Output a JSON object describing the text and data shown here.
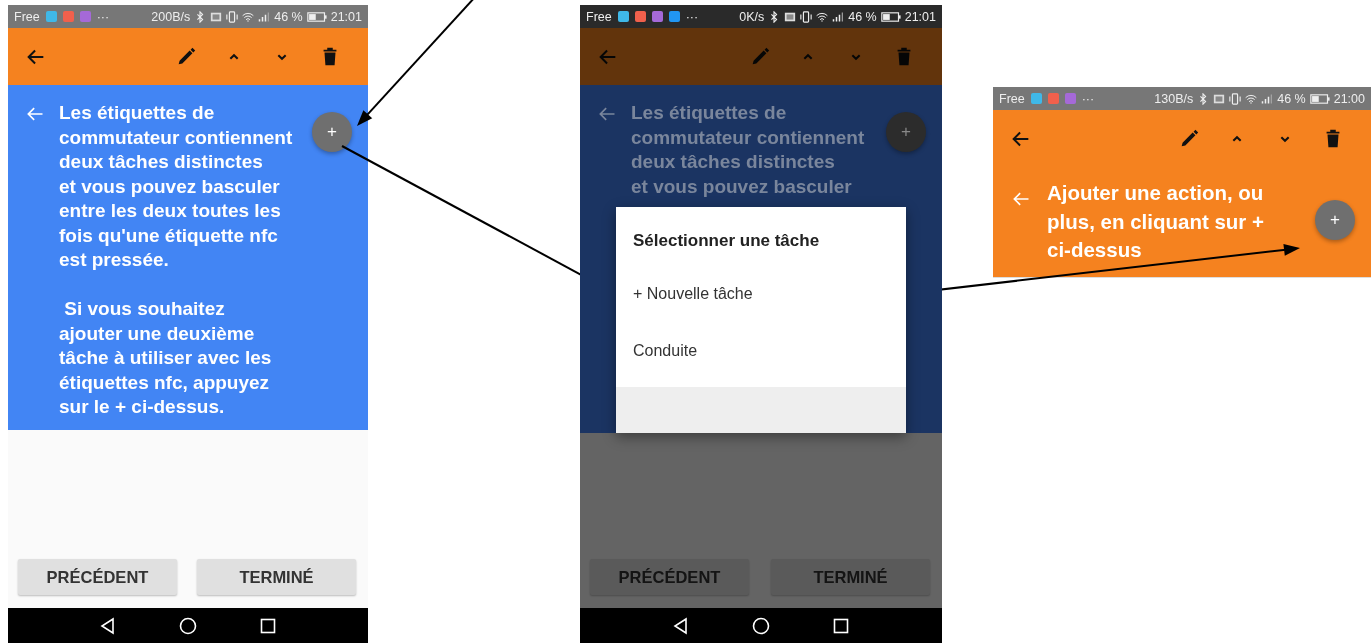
{
  "phones": [
    {
      "dimmed": false,
      "status_bar": {
        "carrier": "Free",
        "notification_icons": [
          {
            "color": "#3fb8e8"
          },
          {
            "color": "#f0604c"
          },
          {
            "color": "#a569d8"
          }
        ],
        "overflow": "···",
        "speed": "200B/s",
        "battery": "46 %",
        "time": "21:01"
      },
      "card": {
        "color": "#4285f4",
        "text": "Les étiquettes de\ncommutateur contiennent\ndeux tâches distinctes\net vous pouvez basculer\nentre les deux toutes les\nfois qu'une étiquette nfc\nest pressée.\n\n Si vous souhaitez\najouter une deuxième\ntâche à utiliser avec les\nétiquettes nfc, appuyez\nsur le + ci-dessus.",
        "fab": "+"
      },
      "buttons": [
        "PRÉCÉDENT",
        "TERMINÉ"
      ]
    },
    {
      "dimmed": true,
      "status_bar": {
        "carrier": "Free",
        "notification_icons": [
          {
            "color": "#3fb8e8"
          },
          {
            "color": "#f0604c"
          },
          {
            "color": "#a569d8"
          },
          {
            "color": "#2196f3"
          }
        ],
        "overflow": "···",
        "speed": "0K/s",
        "battery": "46 %",
        "time": "21:01"
      },
      "card": {
        "color": "#1b3462",
        "text": "Les étiquettes de\ncommutateur contiennent\ndeux tâches distinctes\net vous pouvez basculer",
        "fab": "+"
      },
      "dialog": {
        "title": "Sélectionner une tâche",
        "items": [
          "+ Nouvelle tâche",
          "Conduite"
        ]
      },
      "buttons": [
        "PRÉCÉDENT",
        "TERMINÉ"
      ]
    },
    {
      "dimmed": false,
      "status_bar": {
        "carrier": "Free",
        "notification_icons": [
          {
            "color": "#3fb8e8"
          },
          {
            "color": "#f0604c"
          },
          {
            "color": "#a569d8"
          }
        ],
        "overflow": "···",
        "speed": "130B/s",
        "battery": "46 %",
        "time": "21:00"
      },
      "card": {
        "color": "#f5821f",
        "text": "Ajouter une action, ou\nplus, en cliquant sur +\nci-dessus",
        "fab": "+"
      }
    }
  ]
}
